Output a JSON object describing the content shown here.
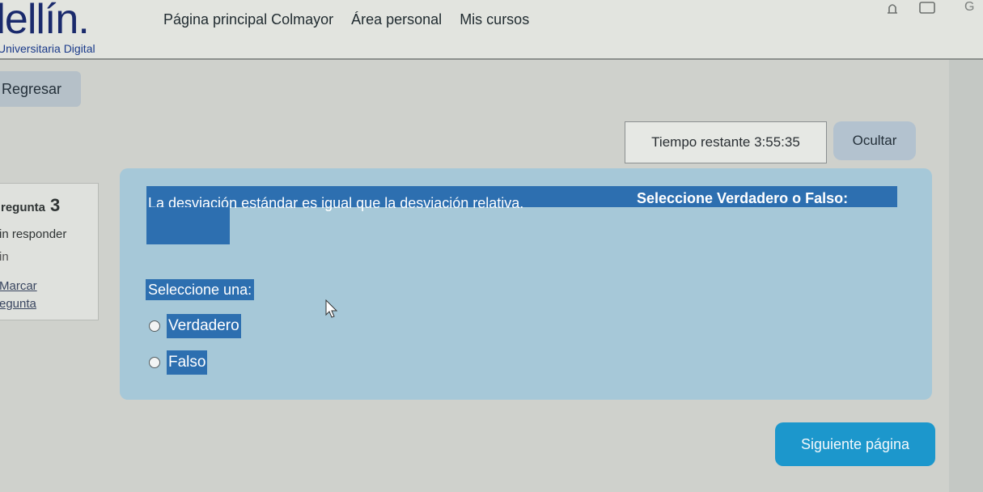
{
  "header": {
    "logo_text": "dellín.",
    "logo_subtitle": "Universitaria Digital",
    "nav": [
      "Página principal Colmayor",
      "Área personal",
      "Mis cursos"
    ],
    "user_initial": "G",
    "icons": [
      "bell-icon",
      "chat-icon"
    ]
  },
  "back_button": "Regresar",
  "timer": {
    "label": "Tiempo restante 3:55:35",
    "hide_button": "Ocultar"
  },
  "question_info": {
    "question_label": "regunta",
    "question_number": "3",
    "status": "in responder",
    "points": "in",
    "flag_line1": "Marcar",
    "flag_line2": "egunta"
  },
  "question": {
    "text": "La desviación estándar es igual que la desviación relativa.",
    "instruction": "Seleccione Verdadero o Falso:",
    "select_prompt": "Seleccione una:",
    "options": [
      "Verdadero",
      "Falso"
    ]
  },
  "footer": {
    "next_button": "Siguiente página"
  },
  "colors": {
    "accent": "#2d6fb0",
    "question_bg": "#a6c8d8",
    "next_button": "#1c97cc"
  }
}
